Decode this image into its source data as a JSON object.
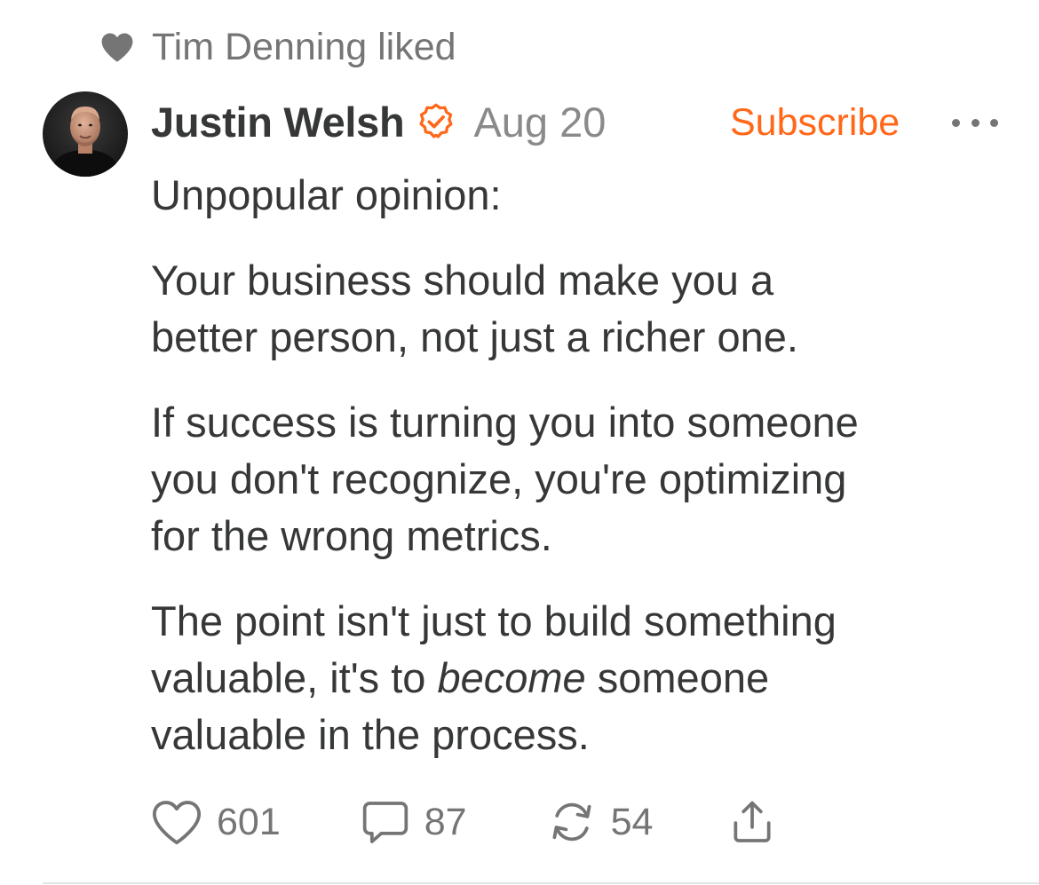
{
  "liked_by": {
    "text": "Tim Denning liked",
    "icon": "heart-filled-icon"
  },
  "post": {
    "author": "Justin Welsh",
    "verified_icon": "verified-badge-icon",
    "date": "Aug 20",
    "subscribe_label": "Subscribe",
    "more_icon": "more-options-icon",
    "body": {
      "p1": "Unpopular opinion:",
      "p2_line1": "Your business should make you a",
      "p2_line2": "better person, not just a richer one.",
      "p3_line1": "If success is turning you into someone",
      "p3_line2": "you don't recognize, you're optimizing",
      "p3_line3": "for the wrong metrics.",
      "p4_line1": "The point isn't just to build something",
      "p4_line2_before": "valuable, it's to ",
      "p4_line2_italic": "become",
      "p4_line2_after": " someone",
      "p4_line3": "valuable in the process."
    }
  },
  "actions": {
    "likes": "601",
    "comments": "87",
    "restacks": "54",
    "like_icon": "heart-outline-icon",
    "comment_icon": "comment-bubble-icon",
    "restack_icon": "restack-icon",
    "share_icon": "share-icon"
  },
  "colors": {
    "accent": "#ff6719",
    "text": "#363737",
    "muted": "#757575"
  }
}
